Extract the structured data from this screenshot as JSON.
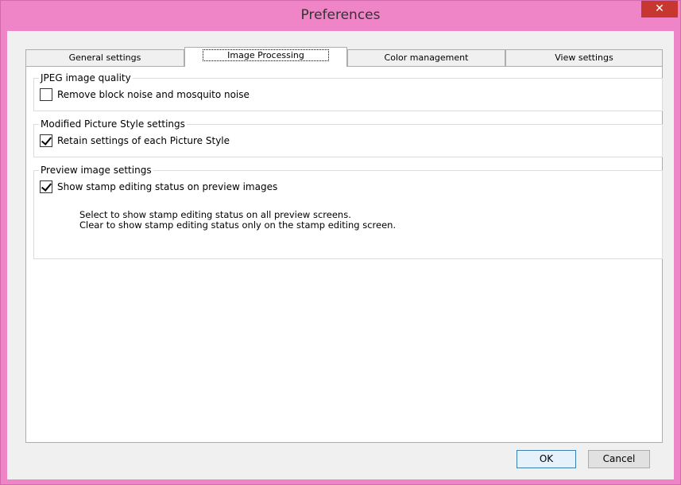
{
  "window": {
    "title": "Preferences",
    "close_glyph": "✕"
  },
  "tabs": [
    {
      "label": "General settings",
      "active": false
    },
    {
      "label": "Image Processing",
      "active": true
    },
    {
      "label": "Color management",
      "active": false
    },
    {
      "label": "View settings",
      "active": false
    }
  ],
  "groups": {
    "jpeg": {
      "title": "JPEG image quality",
      "option": {
        "label": "Remove block noise and mosquito noise",
        "checked": false
      }
    },
    "picture_style": {
      "title": "Modified Picture Style settings",
      "option": {
        "label": "Retain settings of each Picture Style",
        "checked": true
      }
    },
    "preview": {
      "title": "Preview image settings",
      "option": {
        "label": "Show stamp editing status on preview images",
        "checked": true
      },
      "description": [
        "Select to show stamp editing status on all preview screens.",
        "Clear to show stamp editing status only on the stamp editing screen."
      ]
    }
  },
  "buttons": {
    "ok": "OK",
    "cancel": "Cancel"
  },
  "colors": {
    "title_bar": "#ef84c6",
    "close_button": "#c7372f",
    "panel": "#ffffff",
    "dialog_bg": "#f0f0f0"
  }
}
